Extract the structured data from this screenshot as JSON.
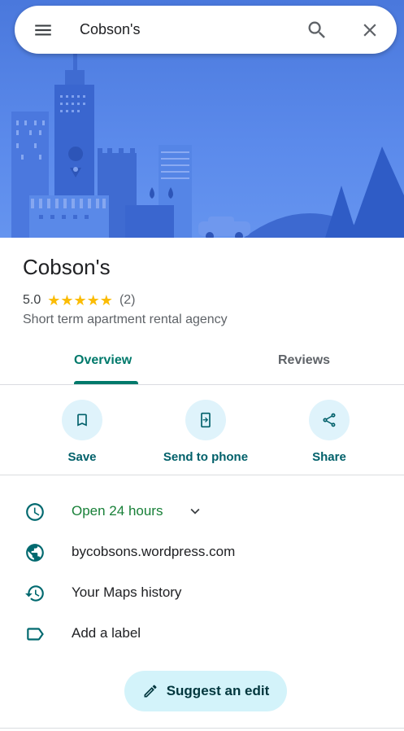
{
  "search": {
    "query": "Cobson's"
  },
  "place": {
    "name": "Cobson's",
    "rating": "5.0",
    "stars": "★★★★★",
    "review_count": "(2)",
    "category": "Short term apartment rental agency"
  },
  "tabs": [
    {
      "label": "Overview",
      "active": true
    },
    {
      "label": "Reviews",
      "active": false
    }
  ],
  "actions": [
    {
      "label": "Save",
      "icon": "bookmark-icon"
    },
    {
      "label": "Send to phone",
      "icon": "send-to-phone-icon"
    },
    {
      "label": "Share",
      "icon": "share-icon"
    }
  ],
  "info": {
    "hours": "Open 24 hours",
    "website": "bycobsons.wordpress.com",
    "history": "Your Maps history",
    "label": "Add a label"
  },
  "suggest_edit": {
    "label": "Suggest an edit"
  },
  "colors": {
    "accent": "#00796b",
    "open_green": "#188038",
    "star": "#fbbc04",
    "hero_blue": "#4a78dc",
    "action_bg": "#dff3fb"
  }
}
